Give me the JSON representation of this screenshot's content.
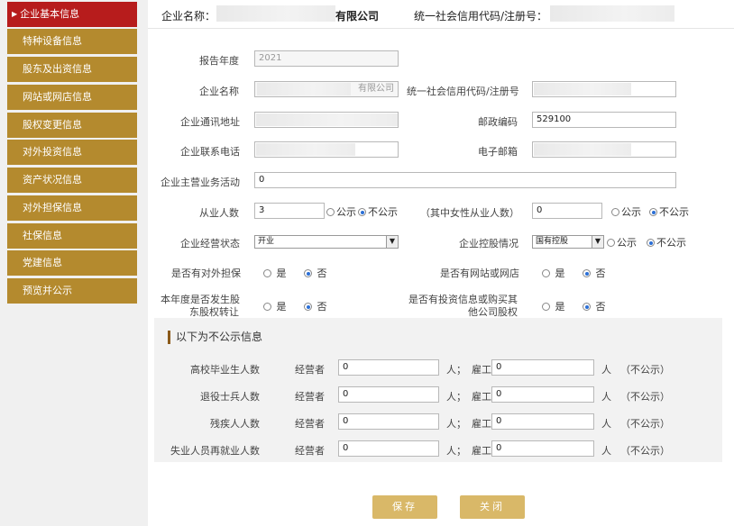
{
  "sidebar": {
    "items": [
      {
        "label": "企业基本信息"
      },
      {
        "label": "特种设备信息"
      },
      {
        "label": "股东及出资信息"
      },
      {
        "label": "网站或网店信息"
      },
      {
        "label": "股权变更信息"
      },
      {
        "label": "对外投资信息"
      },
      {
        "label": "资产状况信息"
      },
      {
        "label": "对外担保信息"
      },
      {
        "label": "社保信息"
      },
      {
        "label": "党建信息"
      },
      {
        "label": "预览并公示"
      }
    ]
  },
  "header": {
    "company_label": "企业名称：",
    "company_suffix": "有限公司",
    "credit_label": "统一社会信用代码/注册号："
  },
  "form": {
    "year_label": "报告年度",
    "year_value": "2021",
    "name_label": "企业名称",
    "name_suffix": "有限公司",
    "credit_label": "统一社会信用代码/注册号",
    "address_label": "企业通讯地址",
    "postcode_label": "邮政编码",
    "postcode_value": "529100",
    "phone_label": "企业联系电话",
    "email_label": "电子邮箱",
    "business_label": "企业主营业务活动",
    "business_value": "0",
    "employees_label": "从业人数",
    "employees_value": "3",
    "female_label": "（其中女性从业人数）",
    "female_value": "0",
    "public": "公示",
    "not_public": "不公示",
    "status_label": "企业经营状态",
    "status_value": "开业",
    "holding_label": "企业控股情况",
    "holding_value": "国有控股",
    "guarantee_label": "是否有对外担保",
    "website_label": "是否有网站或网店",
    "equity_transfer_label_1": "本年度是否发生股",
    "equity_transfer_label_2": "东股权转让",
    "investment_label_1": "是否有投资信息或购买其",
    "investment_label_2": "他公司股权",
    "yes": "是",
    "no": "否"
  },
  "hidden_info": {
    "title": "以下为不公示信息",
    "operator_label": "经营者",
    "employee_label": "雇工",
    "unit_person_sep": "人；",
    "unit_person": "人",
    "not_public_note": "（不公示）",
    "rows": [
      {
        "label": "高校毕业生人数",
        "operator": "0",
        "employee": "0"
      },
      {
        "label": "退役士兵人数",
        "operator": "0",
        "employee": "0"
      },
      {
        "label": "残疾人人数",
        "operator": "0",
        "employee": "0"
      },
      {
        "label": "失业人员再就业人数",
        "operator": "0",
        "employee": "0"
      }
    ]
  },
  "buttons": {
    "save": "保存",
    "close": "关闭"
  },
  "colors": {
    "nav_gold": "#b48a2e",
    "nav_active": "#b71c1c",
    "button_gold": "#d9b868",
    "radio_selected": "#2b6fd6"
  }
}
